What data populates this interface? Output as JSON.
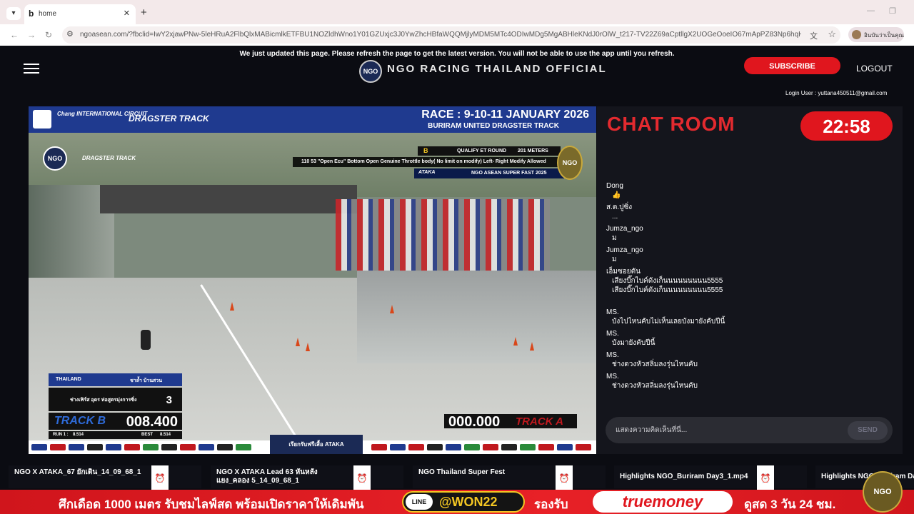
{
  "browser": {
    "tab_title": "home",
    "tab_favicon": "b",
    "url": "ngoasean.com/?fbclid=IwY2xjawPNw-5leHRuA2FlbQlxMABicmlkETFBU1NOZldhWno1Y01GZUxjc3J0YwZhcHBfaWQQMjlyMDM5MTc4ODIwMDg5MgABHleKNdJ0rOlW_t217-TV22Z69aCptllgX2UOGeOoeIO67mApPZ83Np6hqHnS_aem_fwE7TlcNC...",
    "profile_text": "อินบันว่าเป็นคุณ"
  },
  "notice": "We just updated this page. Please refresh the page to get the latest version. You will not be able to use the app until you refresh.",
  "header": {
    "logo_text": "NGO",
    "title": "NGO RACING THAILAND OFFICIAL",
    "subscribe_label": "SUBSCRIBE",
    "logout_label": "LOGOUT",
    "login_user": "Login User : yuttana450511@gmail.com"
  },
  "video": {
    "chang_text": "Chang INTERNATIONAL CIRCUIT",
    "dragster_text": "DRAGSTER TRACK",
    "race_title": "RACE : 9-10-11 JANUARY 2026",
    "race_subtitle": "BURIRAM UNITED DRAGSTER TRACK",
    "class_letter": "B",
    "qualify_label": "QUALIFY ET ROUND",
    "meters": "201 METERS",
    "class_desc": "110 53 \"Open Ecu\" Bottom Open Genuine Throttle body( No limit on modify) Left- Right Modify Allowed",
    "ataka_label": "ATAKA",
    "series_label": "NGO ASEAN SUPER FAST 2025",
    "badge_text": "NGO",
    "scoreboard_left": {
      "country": "THAILAND",
      "rider_name": "ชาล้ำ บ้านสวน",
      "team": "ช่างเฟิร์ส อุดร ท่อสูตรมุ่งการซิ่ง",
      "lane": "3",
      "track_label": "TRACK B",
      "time": "008.400",
      "run1_label": "RUN 1 :",
      "run1_value": "8.514",
      "best_label": "BEST",
      "best_value": "8.514"
    },
    "scoreboard_right": {
      "time": "000.000",
      "track_label": "TRACK A"
    },
    "promo_badge": "เรียกรับฟรีเสื้อ ATAKA"
  },
  "chat": {
    "title": "CHAT ROOM",
    "timer": "22:58",
    "messages": [
      {
        "user": "Dong",
        "text": "👍"
      },
      {
        "user": "ส.ต.ปูซิ่ง",
        "text": "..."
      },
      {
        "user": "Jumza_ngo",
        "text": "ม"
      },
      {
        "user": "Jumza_ngo",
        "text": "ม"
      },
      {
        "user": "เอ็มซอยตัน",
        "text": "เสียงบี๊กไบค์ดังเก็นนนนนนนนน5555"
      },
      {
        "user": "",
        "text": "เสียงบี๊กไบค์ดังเก็นนนนนนนนน5555"
      },
      {
        "user": "MS.",
        "text": "บังไปไหนคับไม่เห็นเลยบังมายังคับปีนี้"
      },
      {
        "user": "MS.",
        "text": "บังมายังคับปีนี้"
      },
      {
        "user": "MS.",
        "text": "ช่างดวงหัวสลิ่มลงรุ่นไหนคับ"
      },
      {
        "user": "MS.",
        "text": "ช่างดวงหัวสลิ่มลงรุ่นไหนคับ"
      }
    ],
    "input_placeholder": "แสดงความคิดเห็นที่นี่...",
    "send_label": "SEND"
  },
  "playlist": [
    {
      "title": "NGO X ATAKA_67 ยักเดิน_14_09_68_1"
    },
    {
      "title": "NGO X ATAKA Lead 63 หันหลัง แยง_คลอง 5_14_09_68_1"
    },
    {
      "title": "NGO Thailand Super Fest"
    },
    {
      "title": "Highlights NGO_Buriram Day3_1.mp4"
    },
    {
      "title": "Highlights NGO_Buriram Da"
    }
  ],
  "ad": {
    "text1": "ศึกเดือด 1000 เมตร รับชมไลฟ์สด พร้อมเปิดราคาให้เดิมพัน",
    "line_label": "LINE",
    "line_id": "@WON22",
    "support": "รองรับ",
    "brand": "truemoney",
    "tail": "ดูสด 3 วัน 24 ชม.",
    "badge": "NGO"
  },
  "colors": {
    "accent_red": "#e0161e",
    "track_blue": "#1f3a8f"
  }
}
